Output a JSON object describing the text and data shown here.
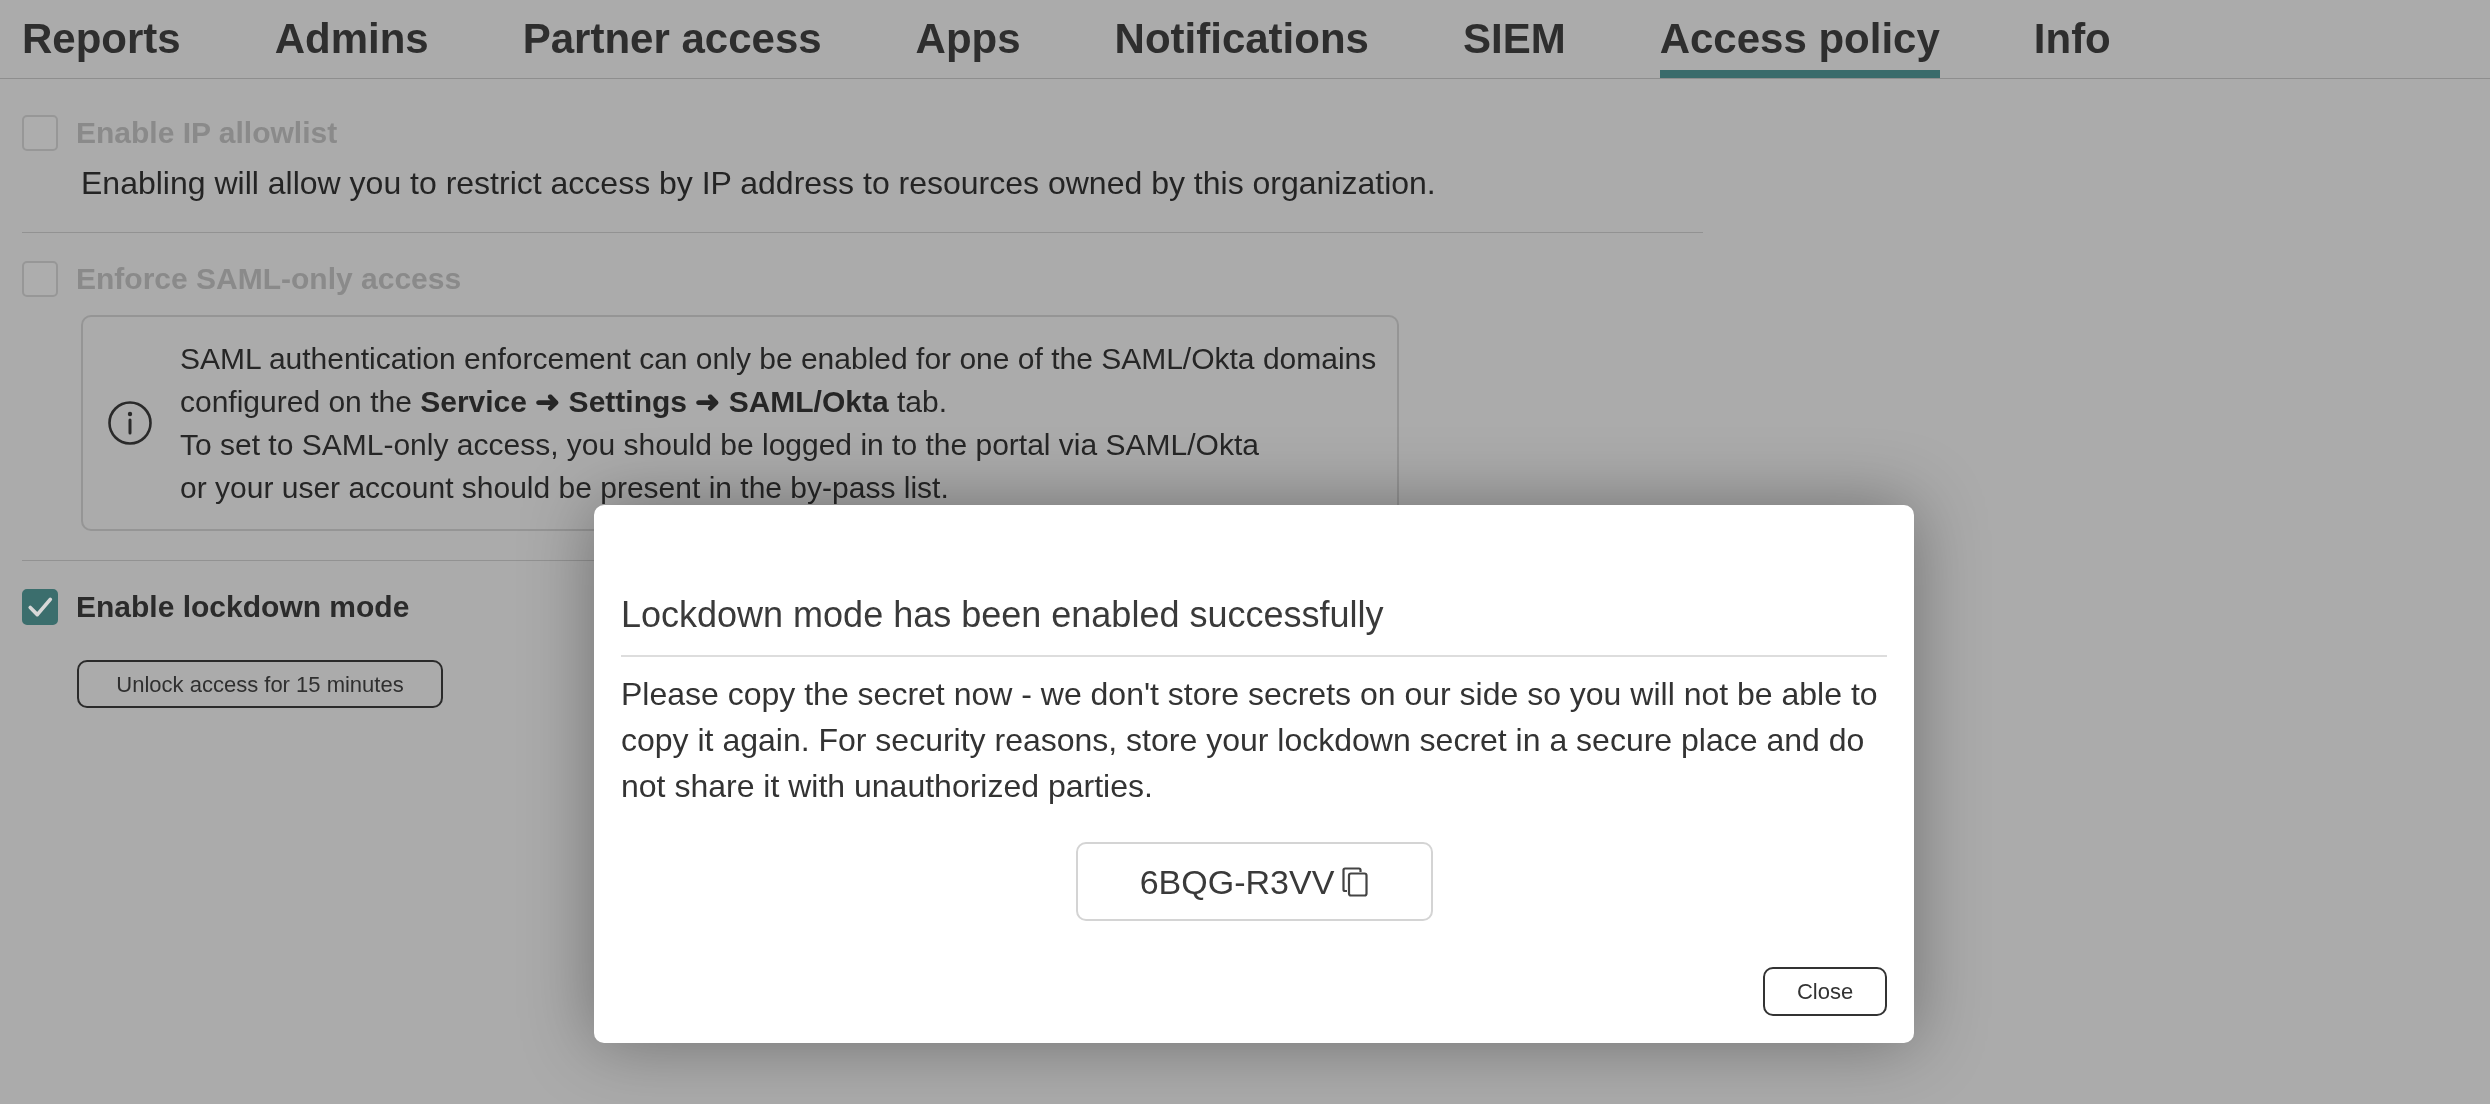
{
  "tabs": [
    {
      "label": "Reports",
      "selected": false
    },
    {
      "label": "Admins",
      "selected": false
    },
    {
      "label": "Partner access",
      "selected": false
    },
    {
      "label": "Apps",
      "selected": false
    },
    {
      "label": "Notifications",
      "selected": false
    },
    {
      "label": "SIEM",
      "selected": false
    },
    {
      "label": "Access policy",
      "selected": true
    },
    {
      "label": "Info",
      "selected": false
    }
  ],
  "settings": [
    {
      "label": "Enable IP allowlist",
      "checked": false,
      "disabled": true,
      "description": "Enabling will allow you to restrict access by IP address to resources owned by this organization."
    },
    {
      "label": "Enforce SAML-only access",
      "checked": false,
      "disabled": true,
      "info_box": [
        "SAML authentication enforcement can only be enabled for one of the SAML/Okta domains configured on the **Service ➜ Settings ➜ SAML/Okta** tab.",
        "To set to SAML-only access, you should be logged in to the portal via SAML/Okta",
        "or your user account should be present in the by-pass list."
      ]
    },
    {
      "label": "Enable lockdown mode",
      "checked": true,
      "disabled": false,
      "button": "Unlock access for 15 minutes"
    }
  ],
  "dialog": {
    "title": "Lockdown mode has been enabled successfully",
    "message": "Please copy the secret now - we don't store secrets on our side so you will not be able to copy it again. For security reasons, store your lockdown secret in a secure place and do not share it with unauthorized parties.",
    "secret": "6BQG-R3VV",
    "buttons": [
      "Close"
    ]
  }
}
